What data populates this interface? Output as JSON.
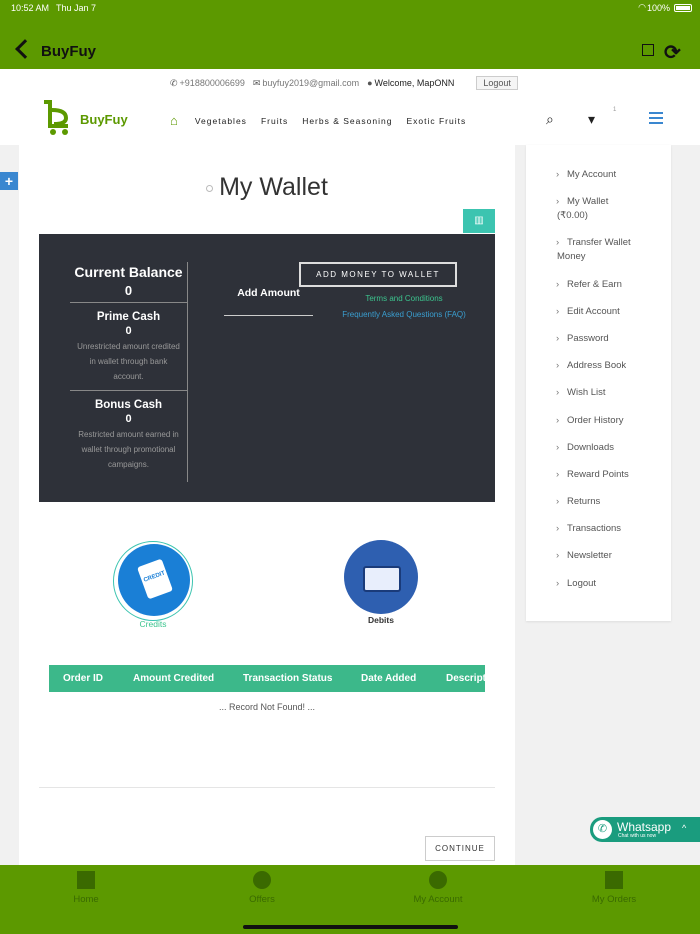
{
  "status_bar": {
    "time": "10:52 AM",
    "date": "Thu Jan 7",
    "battery": "100%"
  },
  "nav": {
    "title": "BuyFuy"
  },
  "header": {
    "phone": "+918800006699",
    "email": "buyfuy2019@gmail.com",
    "welcome": "Welcome, MapONN",
    "logout": "Logout",
    "logo_text": "BuyFuy",
    "cart_count": "1",
    "menu": [
      "Vegetables",
      "Fruits",
      "Herbs & Seasoning",
      "Exotic Fruits"
    ]
  },
  "main": {
    "title": "My Wallet",
    "current_balance_label": "Current Balance",
    "current_balance": "0",
    "prime_cash_label": "Prime Cash",
    "prime_cash": "0",
    "prime_cash_desc": "Unrestricted amount credited in wallet through bank account.",
    "bonus_cash_label": "Bonus Cash",
    "bonus_cash": "0",
    "bonus_cash_desc": "Restricted amount earned in wallet through promotional campaigns.",
    "add_amount_label": "Add Amount",
    "add_money_button": "ADD MONEY TO WALLET",
    "terms_link": "Terms and Conditions",
    "faq_link": "Frequently Asked Questions (FAQ)",
    "credits_label": "Credits",
    "debits_label": "Debits",
    "credit_card_text": "CREDIT",
    "table_headers": [
      "Order ID",
      "Amount Credited",
      "Transaction Status",
      "Date Added",
      "Description"
    ],
    "no_record": "... Record Not Found! ...",
    "continue_button": "CONTINUE"
  },
  "sidebar": {
    "items": [
      "My Account",
      "My Wallet",
      "(₹0.00)",
      "Transfer Wallet",
      "Money",
      "Refer & Earn",
      "Edit Account",
      "Password",
      "Address Book",
      "Wish List",
      "Order History",
      "Downloads",
      "Reward Points",
      "Returns",
      "Transactions",
      "Newsletter",
      "Logout"
    ]
  },
  "whatsapp": {
    "title": "Whatsapp",
    "subtitle": "Chat with us now"
  },
  "tabbar": {
    "items": [
      "Home",
      "Offers",
      "My Account",
      "My Orders"
    ]
  },
  "colors": {
    "brand_green": "#5c9900",
    "teal": "#3cb88a",
    "dark_panel": "#2e3139",
    "blue": "#1a7fd6"
  }
}
